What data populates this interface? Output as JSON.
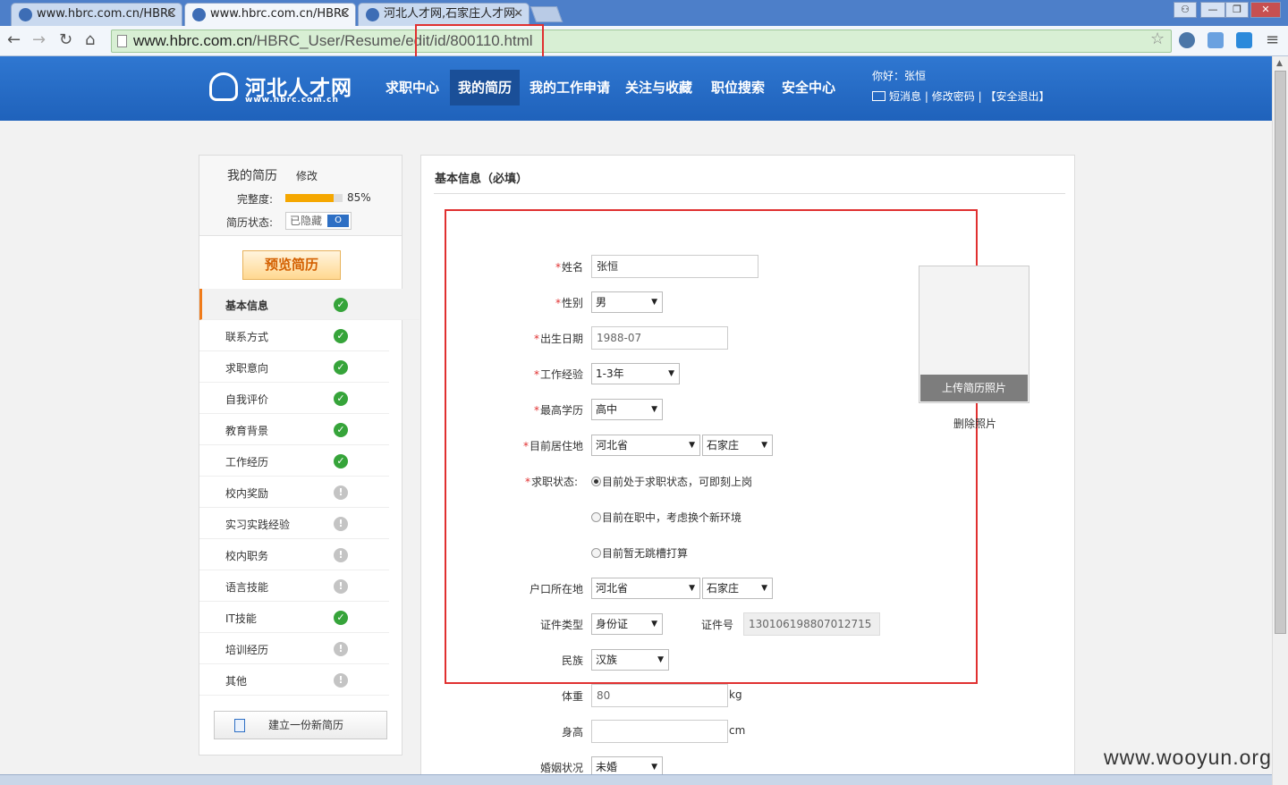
{
  "browser": {
    "tabs": [
      {
        "title": "www.hbrc.com.cn/HBRC"
      },
      {
        "title": "www.hbrc.com.cn/HBRC"
      },
      {
        "title": "河北人才网,石家庄人才网-"
      }
    ],
    "url_host": "www.hbrc.com.cn",
    "url_path": "/HBRC_User/Resume/edit/id/800110.html"
  },
  "site": {
    "logo_cn": "河北人才网",
    "logo_en": "www.hbrc.com.cn",
    "nav": [
      "求职中心",
      "我的简历",
      "我的工作申请",
      "关注与收藏",
      "职位搜索",
      "安全中心"
    ],
    "active_nav": "我的简历",
    "greeting": "你好：张恒",
    "links": [
      "短消息",
      "修改密码",
      "【安全退出】"
    ],
    "link_sep": "|"
  },
  "sidebar": {
    "title": "我的简历",
    "edit": "修改",
    "completeness_label": "完整度:",
    "completeness": 0.85,
    "completeness_text": "85%",
    "status_label": "简历状态:",
    "status_value": "已隐藏",
    "status_toggle": "O",
    "preview_button": "预览简历",
    "items": [
      {
        "label": "基本信息",
        "status": "ok",
        "active": true
      },
      {
        "label": "联系方式",
        "status": "ok"
      },
      {
        "label": "求职意向",
        "status": "ok"
      },
      {
        "label": "自我评价",
        "status": "ok"
      },
      {
        "label": "教育背景",
        "status": "ok"
      },
      {
        "label": "工作经历",
        "status": "ok"
      },
      {
        "label": "校内奖励",
        "status": "warn"
      },
      {
        "label": "实习实践经验",
        "status": "warn"
      },
      {
        "label": "校内职务",
        "status": "warn"
      },
      {
        "label": "语言技能",
        "status": "warn"
      },
      {
        "label": "IT技能",
        "status": "ok"
      },
      {
        "label": "培训经历",
        "status": "warn"
      },
      {
        "label": "其他",
        "status": "warn"
      }
    ],
    "new_resume_button": "建立一份新简历"
  },
  "form": {
    "section_title": "基本信息（必填）",
    "name_label": "姓名",
    "name_value": "张恒",
    "gender_label": "性别",
    "gender_value": "男",
    "birth_label": "出生日期",
    "birth_value": "1988-07",
    "experience_label": "工作经验",
    "experience_value": "1-3年",
    "education_label": "最高学历",
    "education_value": "高中",
    "residence_label": "目前居住地",
    "residence_province": "河北省",
    "residence_city": "石家庄",
    "jobstatus_label": "求职状态:",
    "jobstatus_options": [
      "目前处于求职状态，可即刻上岗",
      "目前在职中，考虑换个新环境",
      "目前暂无跳槽打算"
    ],
    "hukou_label": "户口所在地",
    "hukou_province": "河北省",
    "hukou_city": "石家庄",
    "idtype_label": "证件类型",
    "idtype_value": "身份证",
    "idnum_label": "证件号",
    "idnum_value": "130106198807012715",
    "ethnic_label": "民族",
    "ethnic_value": "汉族",
    "weight_label": "体重",
    "weight_value": "80",
    "weight_unit": "kg",
    "height_label": "身高",
    "height_value": "",
    "height_unit": "cm",
    "marital_label": "婚姻状况",
    "marital_value": "未婚",
    "upload_photo": "上传简历照片",
    "delete_photo": "删除照片"
  },
  "watermark": "www.wooyun.org",
  "colors": {
    "header_blue": "#1f62bb",
    "accent_orange": "#f07b1a",
    "ok_green": "#36a43a",
    "highlight_red": "#e03030"
  }
}
